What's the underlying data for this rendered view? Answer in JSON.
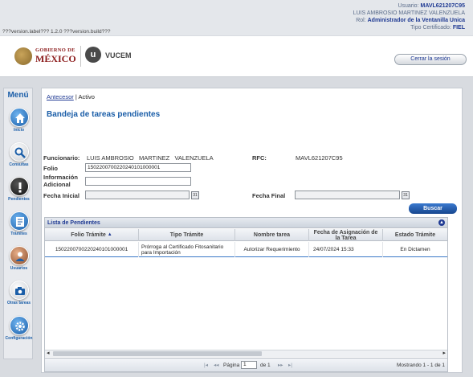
{
  "header": {
    "user_label": "Usuario:",
    "user_rfc": "MAVL621207C95",
    "user_name": "LUIS AMBROSIO MARTINEZ VALENZUELA",
    "role_label": "Rol:",
    "role_value": "Administrador de la Ventanilla Unica",
    "cert_label": "Tipo Certificado:",
    "cert_value": "FIEL",
    "version": "???version.label??? 1.2.0 ???version.build???"
  },
  "logos": {
    "gob_small": "GOBIERNO DE",
    "gob_big": "MÉXICO",
    "vucem_letter": "u",
    "vucem": "VUCEM"
  },
  "logout_label": "Cerrar la sesión",
  "menu": {
    "title": "Menú",
    "items": [
      {
        "label": "Inicio",
        "icon": "home-icon"
      },
      {
        "label": "Consultas",
        "icon": "search-icon"
      },
      {
        "label": "Pendientes",
        "icon": "alert-icon"
      },
      {
        "label": "Trámites",
        "icon": "document-icon"
      },
      {
        "label": "Usuarios",
        "icon": "users-icon"
      },
      {
        "label": "Otras tareas",
        "icon": "camera-icon"
      },
      {
        "label": "Configuración",
        "icon": "gear-icon"
      }
    ]
  },
  "breadcrumb": {
    "link": "Antecesor",
    "separator": "|",
    "current": "Activo"
  },
  "page_title": "Bandeja de tareas pendientes",
  "form": {
    "funcionario_label": "Funcionario:",
    "funcionario_value": "LUIS AMBROSIO   MARTINEZ   VALENZUELA",
    "rfc_label": "RFC:",
    "rfc_value": "MAVL621207C95",
    "folio_label": "Folio",
    "folio_value": "1502200700220240101000001",
    "info_label_1": "Información",
    "info_label_2": "Adicional",
    "info_value": "",
    "fecha_inicial_label": "Fecha Inicial",
    "fecha_inicial_value": "",
    "fecha_final_label": "Fecha Final",
    "fecha_final_value": "",
    "calendar_glyph": "31",
    "search_button": "Buscar"
  },
  "grid": {
    "caption": "Lista de Pendientes",
    "collapse_glyph": "▲",
    "columns": [
      "Folio Trámite",
      "Tipo Trámite",
      "Nombre tarea",
      "Fecha de Asignación de la Tarea",
      "Estado Trámite"
    ],
    "sort_glyph": "▲",
    "rows": [
      {
        "folio": "1502200700220240101000001",
        "tipo": "Prórroga al Certificado Fitosanitario para Importación",
        "tarea": "Autorizar Requerimiento",
        "fecha": "24/07/2024 15:33",
        "estado": "En Dictamen"
      }
    ]
  },
  "pager": {
    "first": "|◂",
    "prev": "◂◂",
    "page_label": "Página",
    "page_value": "1",
    "of_label": "de 1",
    "next": "▸▸",
    "last": "▸|",
    "info": "Mostrando 1 - 1 de 1",
    "scroll_left": "◂",
    "scroll_right": "▸"
  }
}
